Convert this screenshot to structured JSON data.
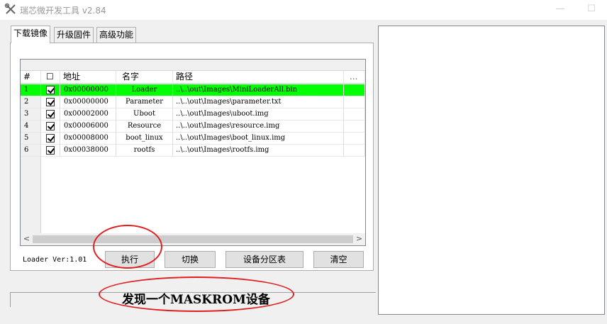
{
  "window": {
    "title": "瑞芯微开发工具 v2.84",
    "icon": "tools-icon",
    "controls": [
      "minimize",
      "maximize"
    ]
  },
  "tabs": [
    {
      "label": "下载镜像",
      "active": true
    },
    {
      "label": "升级固件",
      "active": false
    },
    {
      "label": "高级功能",
      "active": false
    }
  ],
  "table": {
    "columns": [
      "#",
      "☐",
      "地址",
      "名字",
      "路径",
      "..."
    ],
    "rows": [
      {
        "idx": "1",
        "checked": true,
        "address": "0x00000000",
        "name": "Loader",
        "path": "..\\..\\out\\Images\\MiniLoaderAll.bin",
        "selected": true
      },
      {
        "idx": "2",
        "checked": true,
        "address": "0x00000000",
        "name": "Parameter",
        "path": "..\\..\\out\\Images\\parameter.txt",
        "selected": false
      },
      {
        "idx": "3",
        "checked": true,
        "address": "0x00002000",
        "name": "Uboot",
        "path": "..\\..\\out\\Images\\uboot.img",
        "selected": false
      },
      {
        "idx": "4",
        "checked": true,
        "address": "0x00006000",
        "name": "Resource",
        "path": "..\\..\\out\\Images\\resource.img",
        "selected": false
      },
      {
        "idx": "5",
        "checked": true,
        "address": "0x00008000",
        "name": "boot_linux",
        "path": "..\\..\\out\\Images\\boot_linux.img",
        "selected": false
      },
      {
        "idx": "6",
        "checked": true,
        "address": "0x00038000",
        "name": "rootfs",
        "path": "..\\..\\out\\Images\\rootfs.img",
        "selected": false
      }
    ],
    "scroll_left": "<",
    "scroll_right": ">"
  },
  "loader_version": "Loader Ver:1.01",
  "buttons": {
    "run": "执行",
    "switch": "切换",
    "partition_table": "设备分区表",
    "clear": "清空"
  },
  "status": "发现一个MASKROM设备",
  "colors": {
    "selected_row": "#00ff00",
    "annotation": "#e02020",
    "window_bg": "#f0f0f0"
  }
}
